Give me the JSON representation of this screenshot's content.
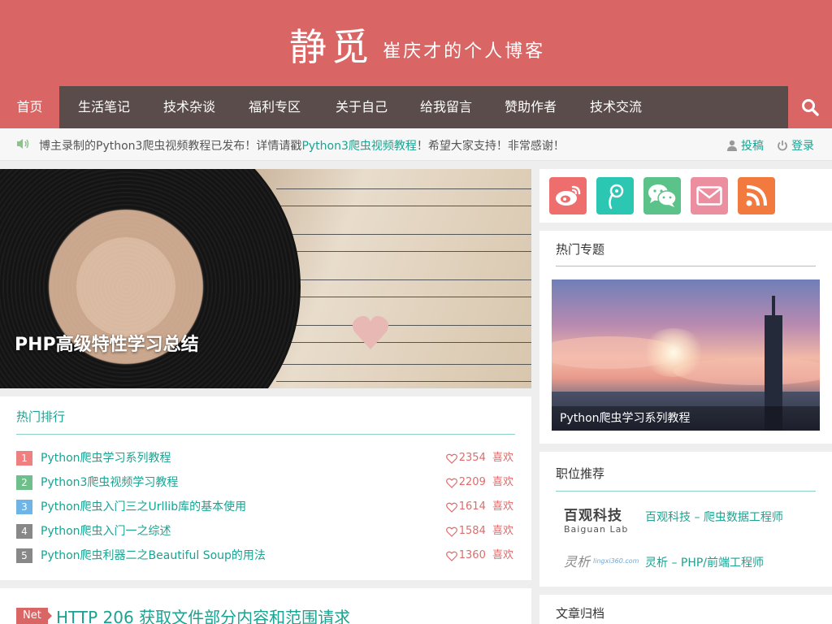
{
  "colors": {
    "brand": "#d96565",
    "nav_bg": "#5a4c4a",
    "link": "#1aa391"
  },
  "header": {
    "logo": "静觅",
    "tagline": "崔庆才的个人博客"
  },
  "nav": {
    "items": [
      {
        "label": "首页",
        "active": true
      },
      {
        "label": "生活笔记"
      },
      {
        "label": "技术杂谈"
      },
      {
        "label": "福利专区"
      },
      {
        "label": "关于自己"
      },
      {
        "label": "给我留言"
      },
      {
        "label": "赞助作者"
      },
      {
        "label": "技术交流"
      }
    ],
    "search_icon": "search-icon"
  },
  "notice": {
    "icon": "speaker-icon",
    "text_before": "博主录制的Python3爬虫视频教程已发布！详情请戳",
    "link": "Python3爬虫视频教程",
    "text_after": "！希望大家支持！非常感谢！",
    "contribute": "投稿",
    "login": "登录"
  },
  "slider": {
    "title": "PHP高级特性学习总结"
  },
  "hot_rank": {
    "title": "热门排行",
    "likes_suffix": "喜欢",
    "items": [
      {
        "num": "1",
        "color": "#f08080",
        "title": "Python爬虫学习系列教程",
        "likes": "2354"
      },
      {
        "num": "2",
        "color": "#6fbf8a",
        "title": "Python3爬虫视频学习教程",
        "likes": "2209"
      },
      {
        "num": "3",
        "color": "#6fb4e6",
        "title": "Python爬虫入门三之Urllib库的基本使用",
        "likes": "1614"
      },
      {
        "num": "4",
        "color": "#888888",
        "title": "Python爬虫入门一之综述",
        "likes": "1584"
      },
      {
        "num": "5",
        "color": "#888888",
        "title": "Python爬虫利器二之Beautiful Soup的用法",
        "likes": "1360"
      }
    ]
  },
  "post": {
    "tag": "Net",
    "title": "HTTP 206 获取文件部分内容和范围请求"
  },
  "social": [
    {
      "icon": "weibo-icon",
      "color": "#ee6d6d"
    },
    {
      "icon": "tencent-weibo-icon",
      "color": "#2cc7b3"
    },
    {
      "icon": "wechat-icon",
      "color": "#5bc28a"
    },
    {
      "icon": "mail-icon",
      "color": "#ea8ea0"
    },
    {
      "icon": "rss-icon",
      "color": "#f27a3f"
    }
  ],
  "topic": {
    "title": "热门专题",
    "caption": "Python爬虫学习系列教程"
  },
  "jobs": {
    "title": "职位推荐",
    "items": [
      {
        "logo_main": "百观科技",
        "logo_sub": "Baiguan Lab",
        "link": "百观科技 – 爬虫数据工程师"
      },
      {
        "logo_main": "灵析",
        "logo_sub": "lingxi360.com",
        "link": "灵析 – PHP/前端工程师"
      }
    ]
  },
  "archive": {
    "title": "文章归档"
  }
}
